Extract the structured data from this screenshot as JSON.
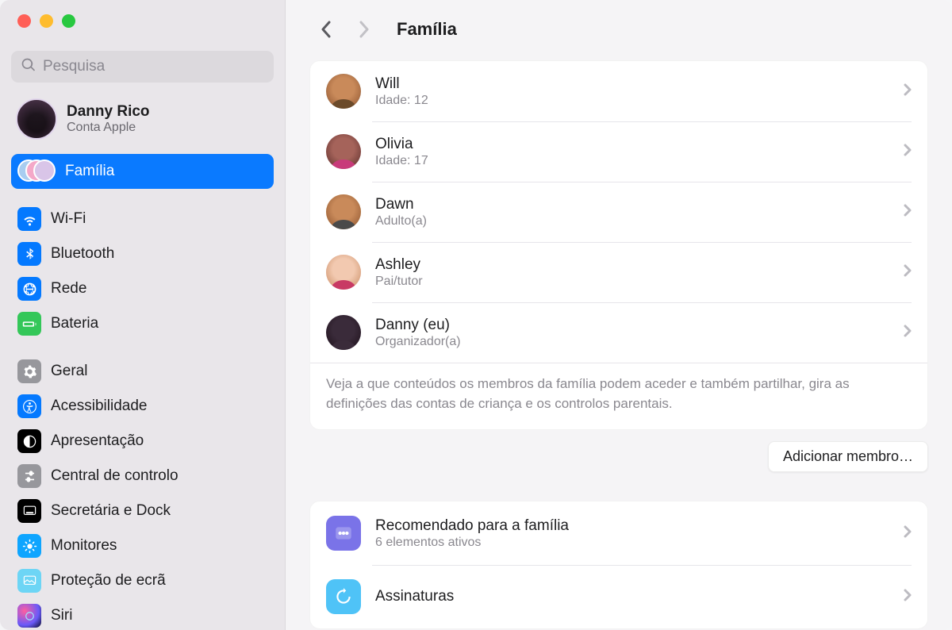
{
  "search": {
    "placeholder": "Pesquisa"
  },
  "user": {
    "name": "Danny Rico",
    "sub": "Conta Apple"
  },
  "page_title": "Família",
  "sidebar": {
    "family": "Família",
    "items": [
      {
        "label": "Wi‑Fi"
      },
      {
        "label": "Bluetooth"
      },
      {
        "label": "Rede"
      },
      {
        "label": "Bateria"
      },
      {
        "label": "Geral"
      },
      {
        "label": "Acessibilidade"
      },
      {
        "label": "Apresentação"
      },
      {
        "label": "Central de controlo"
      },
      {
        "label": "Secretária e Dock"
      },
      {
        "label": "Monitores"
      },
      {
        "label": "Proteção de ecrã"
      },
      {
        "label": "Siri"
      }
    ]
  },
  "colors": {
    "wifi": "#0479ff",
    "bluetooth": "#0479ff",
    "network": "#0479ff",
    "battery": "#34c759",
    "general": "#97979c",
    "accessibility": "#0479ff",
    "displays": "#000000",
    "controlcenter": "#97979c",
    "desktop": "#000000",
    "monitors": "#0ea5ff",
    "screensaver": "#6dd5f5",
    "recommended": "#7a73e8",
    "subscriptions": "#4fc3f7"
  },
  "members": [
    {
      "name": "Will",
      "role": "Idade: 12",
      "bg": "#b8def2",
      "skin": "#c98a5a",
      "skin2": "#a86c42",
      "body": "#6b4a2a"
    },
    {
      "name": "Olivia",
      "role": "Idade: 17",
      "bg": "#f4b4cc",
      "skin": "#a5635a",
      "skin2": "#7d4640",
      "body": "#c83a7a"
    },
    {
      "name": "Dawn",
      "role": "Adulto(a)",
      "bg": "#f3d18a",
      "skin": "#c98a5a",
      "skin2": "#a86c42",
      "body": "#4a4a4a"
    },
    {
      "name": "Ashley",
      "role": "Pai/tutor",
      "bg": "#f5b4b4",
      "skin": "#f2c9b0",
      "skin2": "#dba886",
      "body": "#c83a64"
    },
    {
      "name": "Danny (eu)",
      "role": "Organizador(a)",
      "bg": "#d9c5e8",
      "skin": "#3a2b3a",
      "skin2": "#2a1c28",
      "body": "#3a2b3a"
    }
  ],
  "description": "Veja a que conteúdos os membros da família podem aceder e também partilhar, gira as definições das contas de criança e os controlos parentais.",
  "add_button": "Adicionar membro…",
  "extras": [
    {
      "title": "Recomendado para a família",
      "sub": "6 elementos ativos",
      "icon": "recommended"
    },
    {
      "title": "Assinaturas",
      "sub": "",
      "icon": "subscriptions"
    }
  ]
}
